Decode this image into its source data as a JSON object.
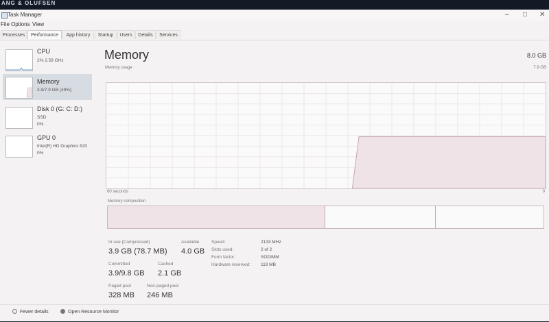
{
  "bezel": {
    "brand": "ANG & OLUFSEN"
  },
  "window": {
    "title": "Task Manager",
    "controls": {
      "minimize": "–",
      "maximize": "□",
      "close": "✕"
    }
  },
  "menu": [
    "File",
    "Options",
    "View"
  ],
  "tabs": [
    "Processes",
    "Performance",
    "App history",
    "Startup",
    "Users",
    "Details",
    "Services"
  ],
  "active_tab": "Performance",
  "sidebar": [
    {
      "name": "CPU",
      "line1": "2% 2.59 GHz",
      "line2": ""
    },
    {
      "name": "Memory",
      "line1": "3.9/7.9 GB (49%)",
      "line2": ""
    },
    {
      "name": "Disk 0 (G: C: D:)",
      "line1": "SSD",
      "line2": "0%"
    },
    {
      "name": "GPU 0",
      "line1": "Intel(R) HD Graphics 520",
      "line2": "0%"
    }
  ],
  "main": {
    "title": "Memory",
    "total": "8.0 GB",
    "usage_label": "Memory usage",
    "usage_max": "7.9 GB",
    "axis_left": "60 seconds",
    "axis_right": "0",
    "composition_label": "Memory composition",
    "usage_fraction_recent": 0.49
  },
  "stats": {
    "in_use_label": "In use (Compressed)",
    "in_use_value": "3.9 GB (78.7 MB)",
    "available_label": "Available",
    "available_value": "4.0 GB",
    "committed_label": "Committed",
    "committed_value": "3.9/9.8 GB",
    "cached_label": "Cached",
    "cached_value": "2.1 GB",
    "paged_label": "Paged pool",
    "paged_value": "328 MB",
    "nonpaged_label": "Non-paged pool",
    "nonpaged_value": "246 MB"
  },
  "specs": [
    {
      "label": "Speed:",
      "value": "2133 MHz"
    },
    {
      "label": "Slots used:",
      "value": "2 of 2"
    },
    {
      "label": "Form factor:",
      "value": "SODIMM"
    },
    {
      "label": "Hardware reserved:",
      "value": "119 MB"
    }
  ],
  "footer": {
    "fewer_details": "Fewer details",
    "resource_monitor": "Open Resource Monitor"
  },
  "colors": {
    "accent": "#8b1a5a",
    "fill": "#efe3e8",
    "line": "#c7a6b8"
  }
}
